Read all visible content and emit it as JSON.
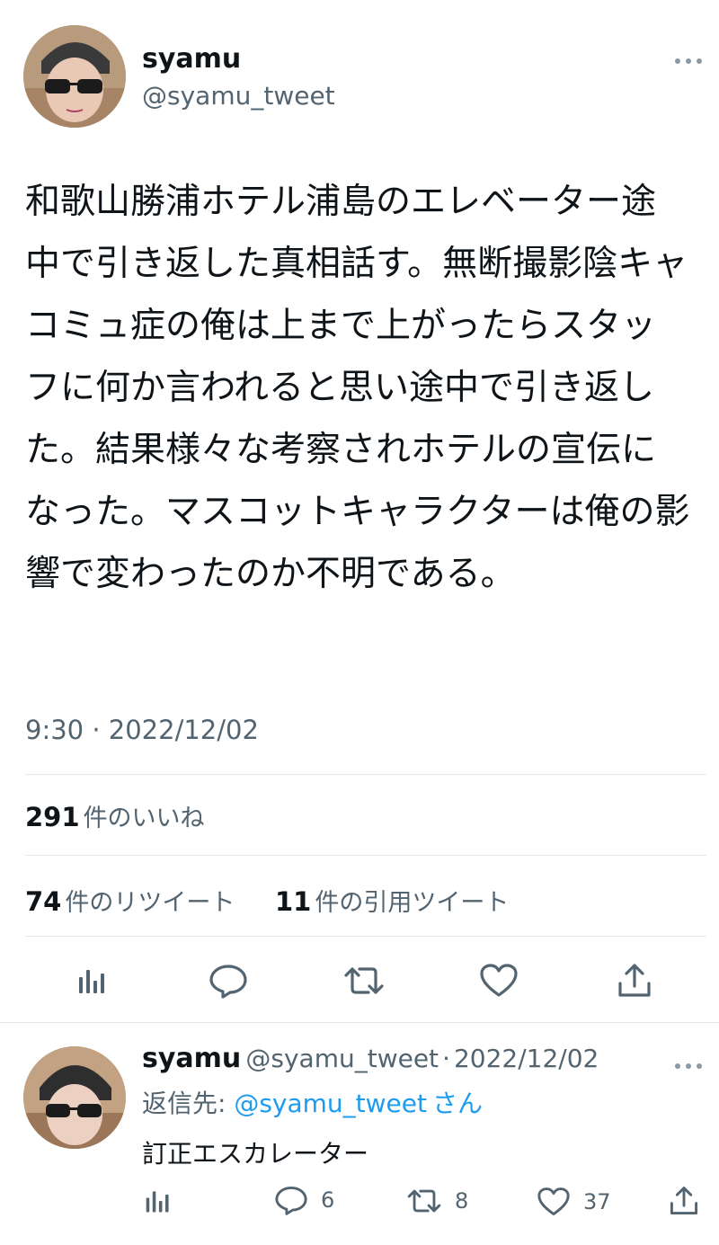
{
  "main_tweet": {
    "author_name": "syamu",
    "author_handle": "@syamu_tweet",
    "more_icon": "more-icon",
    "text": "和歌山勝浦ホテル浦島のエレベーター途中で引き返した真相話す。無断撮影陰キャコミュ症の俺は上まで上がったらスタッフに何か言われると思い途中で引き返した。結果様々な考察されホテルの宣伝になった。マスコットキャラクターは俺の影響で変わったのか不明である。",
    "time": "9:30 · 2022/12/02",
    "likes_count": "291",
    "likes_label": "件のいいね",
    "retweets_count": "74",
    "retweets_label": "件のリツイート",
    "quotes_count": "11",
    "quotes_label": "件の引用ツイート"
  },
  "reply_tweet": {
    "author_name": "syamu",
    "author_handle": "@syamu_tweet",
    "separator": "·",
    "date": "2022/12/02",
    "reply_prefix": "返信先:",
    "reply_to": "@syamu_tweet",
    "reply_suffix": "さん",
    "text": "訂正エスカレーター",
    "replies": "6",
    "retweets": "8",
    "likes": "37"
  },
  "colors": {
    "text": "#0f1419",
    "secondary": "#536471",
    "link": "#1d9bf0",
    "divider": "#e6e9eb"
  }
}
